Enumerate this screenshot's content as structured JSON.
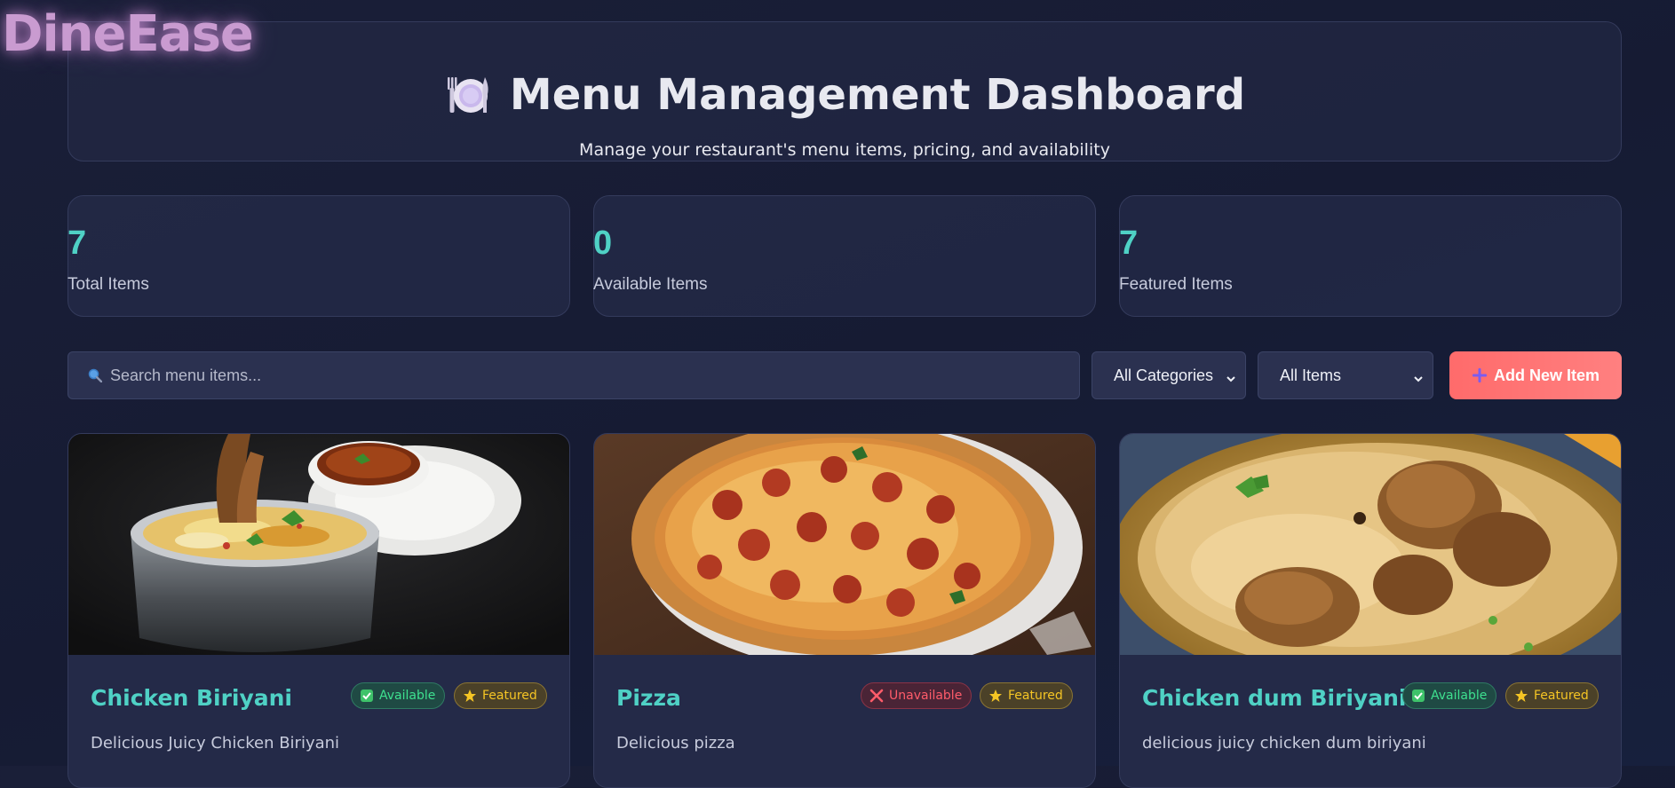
{
  "brand": {
    "name": "DineEase"
  },
  "header": {
    "title": "Menu Management Dashboard",
    "subtitle": "Manage your restaurant's menu items, pricing, and availability",
    "icon": "plate-cutlery-icon"
  },
  "stats": [
    {
      "value": "7",
      "label": "Total Items"
    },
    {
      "value": "0",
      "label": "Available Items"
    },
    {
      "value": "7",
      "label": "Featured Items"
    }
  ],
  "toolbar": {
    "search_placeholder": "Search menu items...",
    "category_select": "All Categories",
    "items_select": "All Items",
    "add_button_label": "Add New Item"
  },
  "menu_items": [
    {
      "name": "Chicken Biriyani",
      "description": "Delicious Juicy Chicken Biriyani",
      "status": "Available",
      "featured": "Featured",
      "image": "chicken-biriyani-photo"
    },
    {
      "name": "Pizza",
      "description": "Delicious pizza",
      "status": "Unavailable",
      "featured": "Featured",
      "image": "pepperoni-pizza-photo"
    },
    {
      "name": "Chicken dum Biriyani",
      "description": "delicious juicy chicken dum biriyani",
      "status": "Available",
      "featured": "Featured",
      "image": "chicken-dum-biriyani-photo"
    }
  ],
  "colors": {
    "accent": "#4fd1c5",
    "add_button": "#ff6b6b",
    "available": "#3ee08f",
    "unavailable": "#ff5c6a",
    "featured": "#f5c524",
    "brand": "#c99bd0"
  }
}
